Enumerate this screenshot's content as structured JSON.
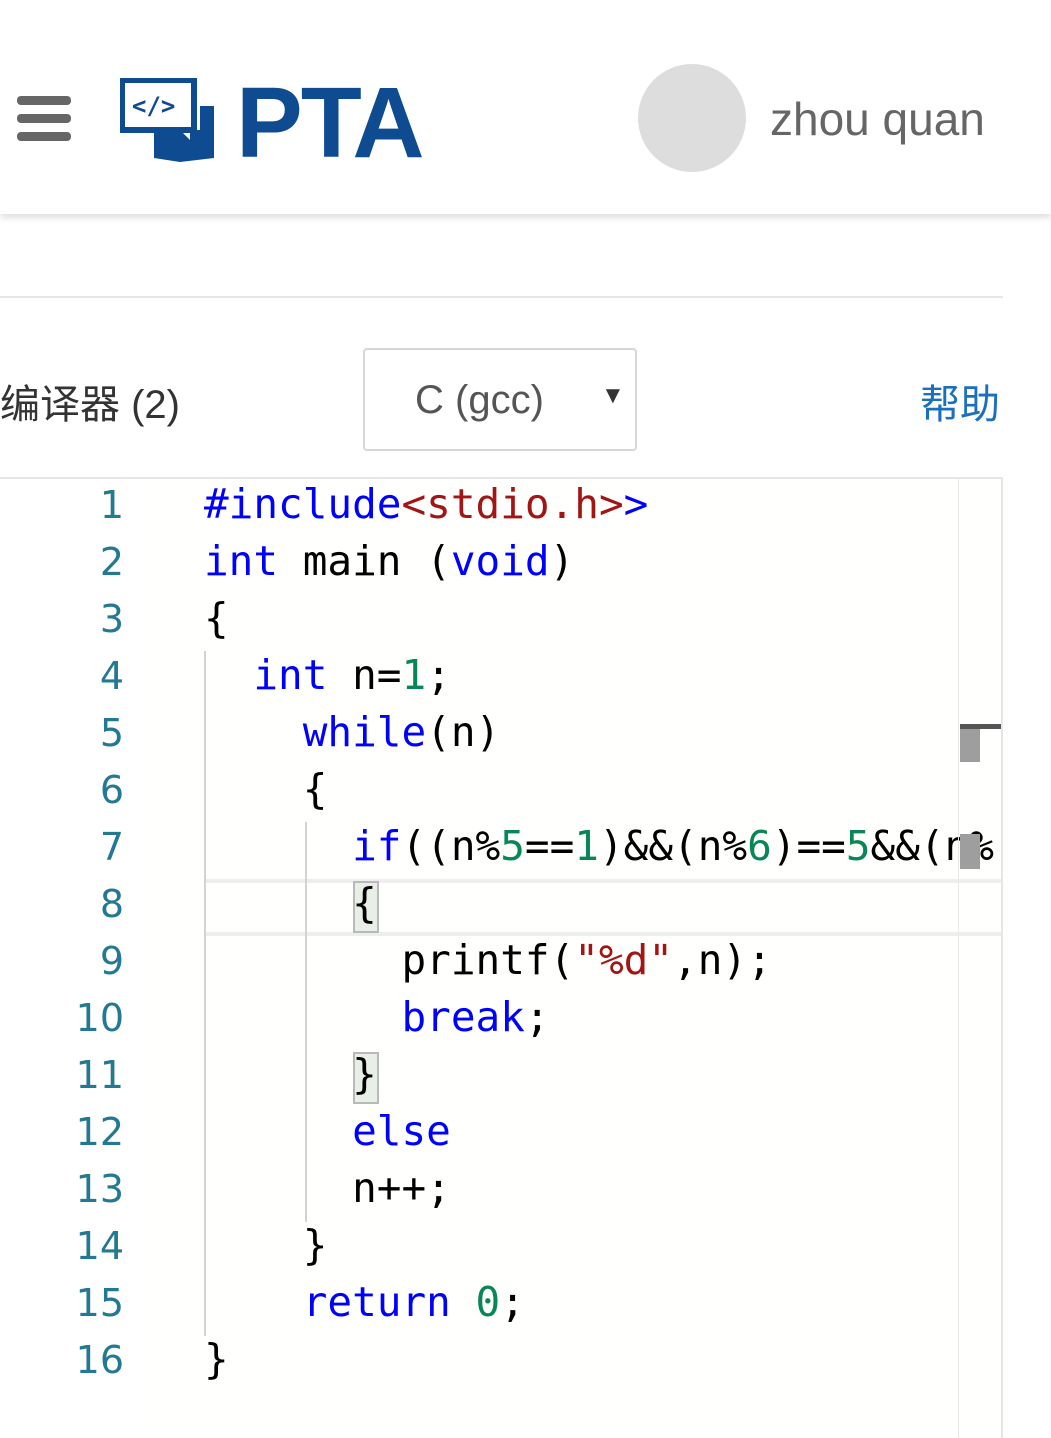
{
  "header": {
    "logo_text": "PTA",
    "username": "zhou quan",
    "brand_color": "#0f4b91",
    "menu_icon": "hamburger-icon"
  },
  "toolbar": {
    "compiler_label": "编译器 (2)",
    "compiler_value": "C (gcc)",
    "help_label": "帮助"
  },
  "editor": {
    "line_numbers": [
      "1",
      "2",
      "3",
      "4",
      "5",
      "6",
      "7",
      "8",
      "9",
      "10",
      "11",
      "12",
      "13",
      "14",
      "15",
      "16"
    ],
    "lines": [
      [
        {
          "t": "#include",
          "c": "kw"
        },
        {
          "t": "<stdio.h>",
          "c": "str"
        },
        {
          "t": ">",
          "c": "kw"
        }
      ],
      [
        {
          "t": "int",
          "c": "kw"
        },
        {
          "t": " main (",
          "c": ""
        },
        {
          "t": "void",
          "c": "kw"
        },
        {
          "t": ")",
          "c": ""
        }
      ],
      [
        {
          "t": "{",
          "c": ""
        }
      ],
      [
        {
          "t": "  "
        },
        {
          "t": "int",
          "c": "kw"
        },
        {
          "t": " n=",
          "c": ""
        },
        {
          "t": "1",
          "c": "num"
        },
        {
          "t": ";",
          "c": ""
        }
      ],
      [
        {
          "t": "    "
        },
        {
          "t": "while",
          "c": "kw"
        },
        {
          "t": "(n)",
          "c": ""
        }
      ],
      [
        {
          "t": "    {",
          "c": ""
        }
      ],
      [
        {
          "t": "      "
        },
        {
          "t": "if",
          "c": "kw"
        },
        {
          "t": "((n%",
          "c": ""
        },
        {
          "t": "5",
          "c": "num"
        },
        {
          "t": "==",
          "c": ""
        },
        {
          "t": "1",
          "c": "num"
        },
        {
          "t": ")&&(n%",
          "c": ""
        },
        {
          "t": "6",
          "c": "num"
        },
        {
          "t": ")==",
          "c": ""
        },
        {
          "t": "5",
          "c": "num"
        },
        {
          "t": "&&(n%",
          "c": ""
        }
      ],
      [
        {
          "t": "      {",
          "c": ""
        }
      ],
      [
        {
          "t": "        printf(",
          "c": ""
        },
        {
          "t": "\"%d\"",
          "c": "str"
        },
        {
          "t": ",n);",
          "c": ""
        }
      ],
      [
        {
          "t": "        "
        },
        {
          "t": "break",
          "c": "kw"
        },
        {
          "t": ";",
          "c": ""
        }
      ],
      [
        {
          "t": "      }",
          "c": ""
        }
      ],
      [
        {
          "t": "      "
        },
        {
          "t": "else",
          "c": "kw"
        }
      ],
      [
        {
          "t": "      n++;",
          "c": ""
        }
      ],
      [
        {
          "t": "    }",
          "c": ""
        }
      ],
      [
        {
          "t": "    "
        },
        {
          "t": "return",
          "c": "kw"
        },
        {
          "t": " ",
          "c": ""
        },
        {
          "t": "0",
          "c": "num"
        },
        {
          "t": ";",
          "c": ""
        }
      ],
      [
        {
          "t": "}",
          "c": ""
        }
      ]
    ]
  }
}
